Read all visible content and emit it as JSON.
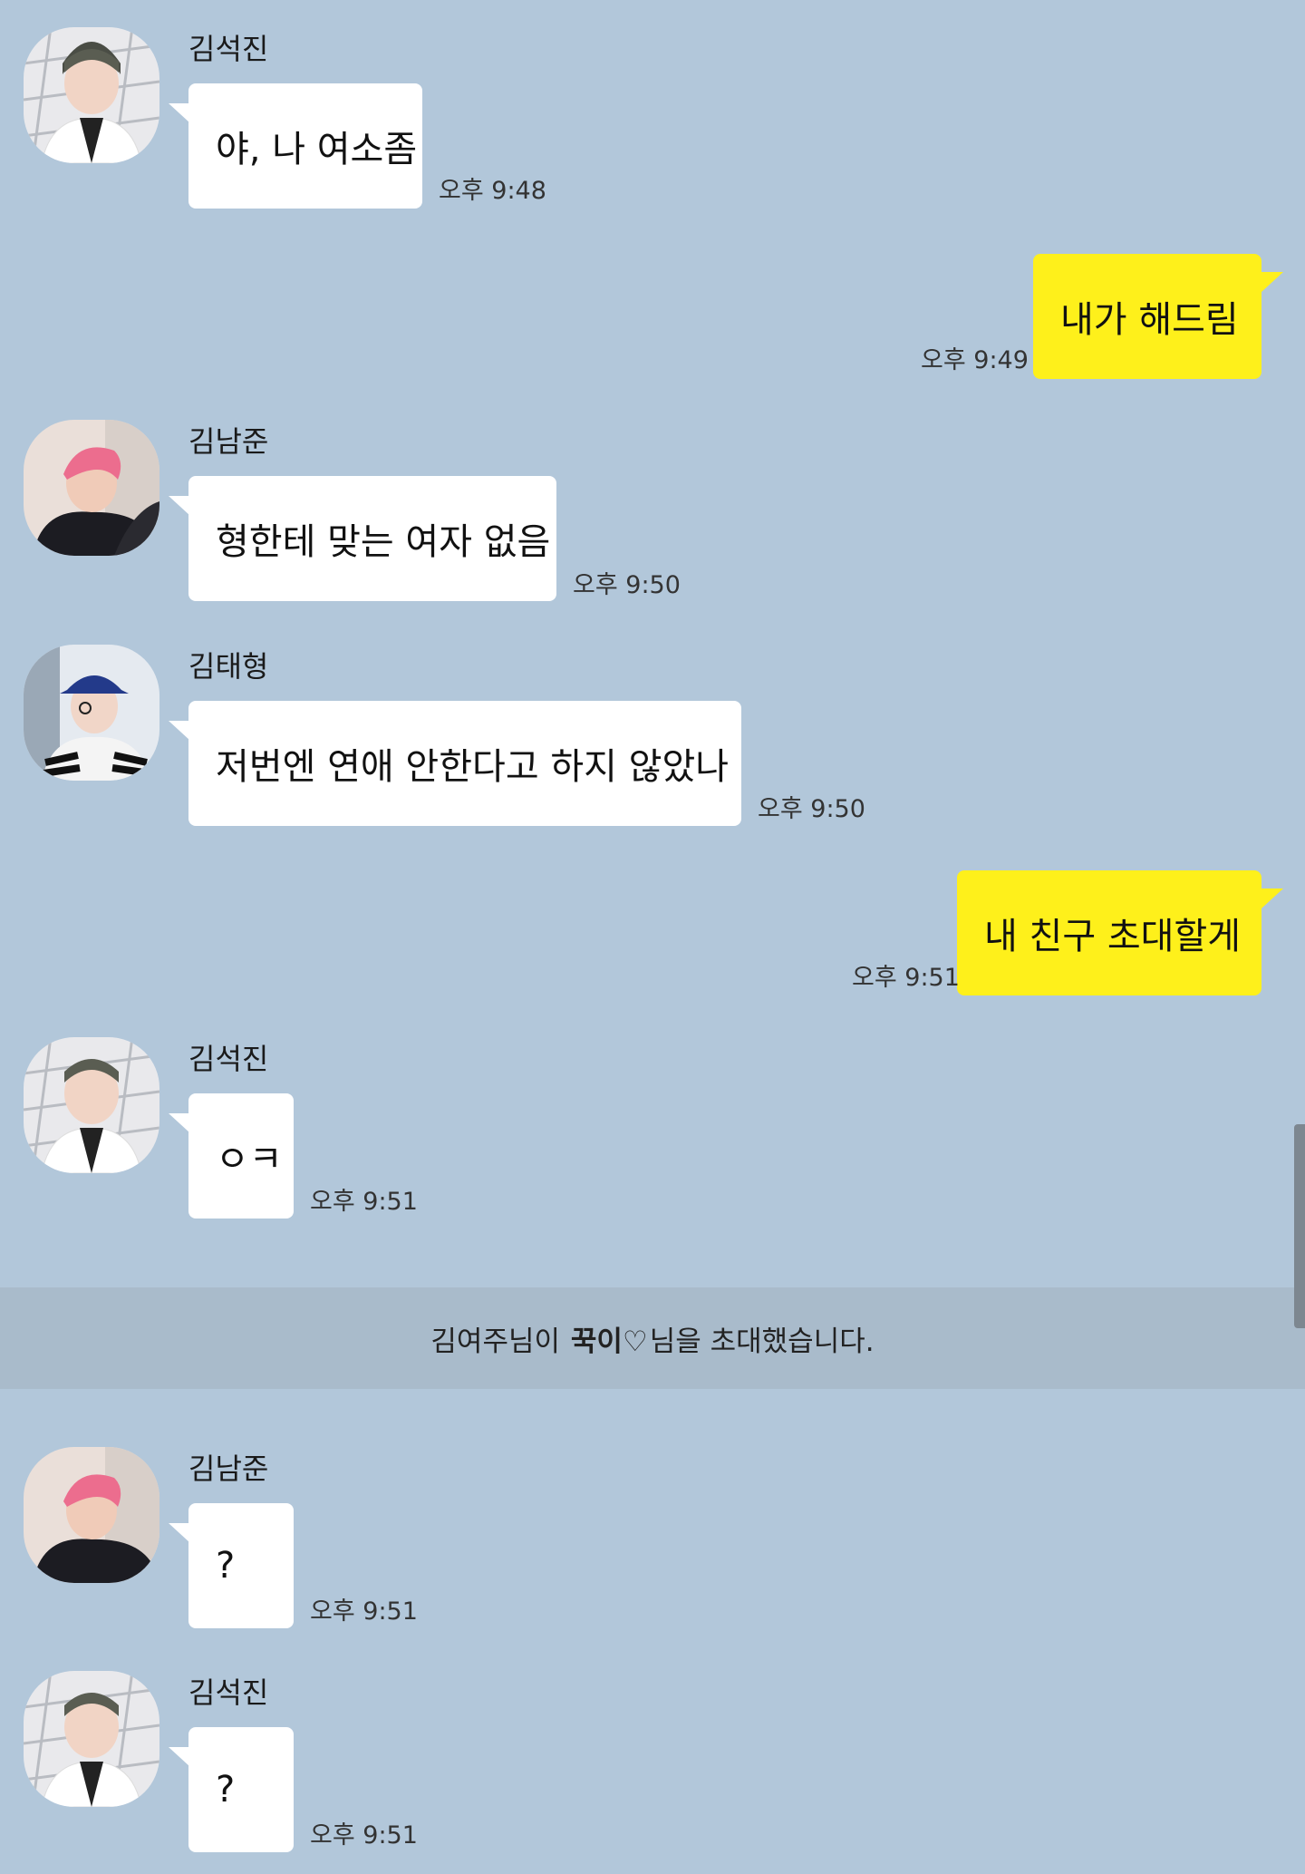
{
  "messages": [
    {
      "sender": "김석진",
      "text": "야, 나 여소좀",
      "time": "오후 9:48"
    },
    {
      "text": "내가 해드림",
      "time": "오후 9:49"
    },
    {
      "sender": "김남준",
      "text": "형한테 맞는 여자 없음",
      "time": "오후 9:50"
    },
    {
      "sender": "김태형",
      "text": "저번엔 연애 안한다고 하지 않았나",
      "time": "오후 9:50"
    },
    {
      "text": "내 친구 초대할게",
      "time": "오후 9:51"
    },
    {
      "sender": "김석진",
      "text": "ㅇㅋ",
      "time": "오후 9:51"
    },
    {
      "sender": "김남준",
      "text": "?",
      "time": "오후 9:51"
    },
    {
      "sender": "김석진",
      "text": "?",
      "time": "오후 9:51"
    }
  ],
  "system_notice": {
    "inviter": "김여주님이",
    "invitee": "꾹이♡",
    "suffix": "님을 초대했습니다."
  },
  "colors": {
    "background": "#b2c7da",
    "incoming_bubble": "#ffffff",
    "outgoing_bubble": "#fef01b",
    "notice_band": "#a9bbcb"
  },
  "icons": [
    "avatar-seokjin",
    "avatar-namjoon",
    "avatar-taehyung"
  ]
}
